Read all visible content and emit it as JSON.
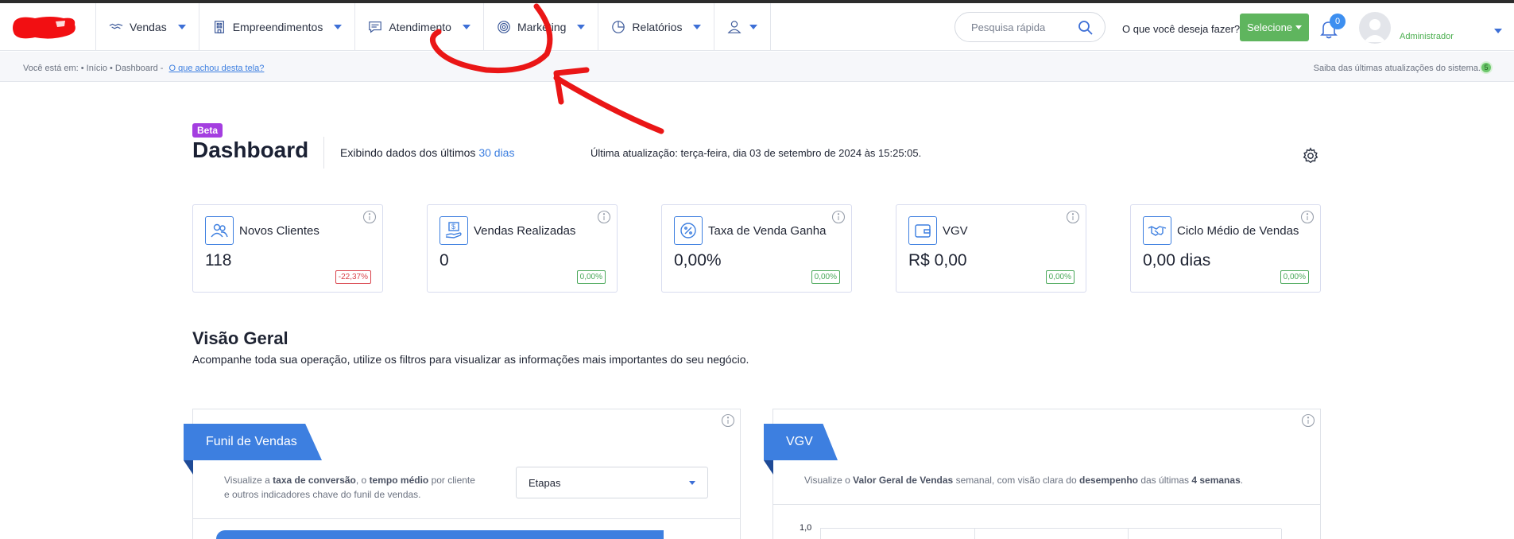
{
  "nav": {
    "items": [
      {
        "label": "Vendas",
        "icon": "handshake-icon"
      },
      {
        "label": "Empreendimentos",
        "icon": "building-icon"
      },
      {
        "label": "Atendimento",
        "icon": "chat-icon"
      },
      {
        "label": "Marketing",
        "icon": "target-icon"
      },
      {
        "label": "Relatórios",
        "icon": "pie-chart-icon"
      },
      {
        "label": "",
        "icon": "user-icon"
      }
    ],
    "search_placeholder": "Pesquisa rápida",
    "what_to_do": "O que você deseja fazer?",
    "select_label": "Selecione",
    "notification_count": "0",
    "user_role": "Administrador",
    "accent_color": "#3d7fe0",
    "select_color": "#5fb55e"
  },
  "breadcrumb": {
    "prefix": "Você está em: • Início • Dashboard -",
    "feedback_link": "O que achou desta tela?",
    "updates_text": "Saiba das últimas atualizações do sistema.",
    "updates_count": "5"
  },
  "header": {
    "beta": "Beta",
    "title": "Dashboard",
    "showing_prefix": "Exibindo dados dos últimos",
    "showing_period": "30 dias",
    "last_update": "Última atualização: terça-feira, dia 03 de setembro de 2024 às 15:25:05."
  },
  "kpis": [
    {
      "label": "Novos Clientes",
      "value": "118",
      "change": "-22,37%",
      "trend": "negative",
      "icon": "users-icon"
    },
    {
      "label": "Vendas Realizadas",
      "value": "0",
      "change": "0,00%",
      "trend": "positive",
      "icon": "money-hand-icon"
    },
    {
      "label": "Taxa de Venda Ganha",
      "value": "0,00%",
      "change": "0,00%",
      "trend": "positive",
      "icon": "percent-badge-icon"
    },
    {
      "label": "VGV",
      "value": "R$ 0,00",
      "change": "0,00%",
      "trend": "positive",
      "icon": "wallet-icon"
    },
    {
      "label": "Ciclo Médio de Vendas",
      "value": "0,00 dias",
      "change": "0,00%",
      "trend": "positive",
      "icon": "deal-handshake-icon"
    }
  ],
  "overview": {
    "title": "Visão Geral",
    "subtitle": "Acompanhe toda sua operação, utilize os filtros para visualizar as informações mais importantes do seu negócio."
  },
  "funnel_panel": {
    "ribbon": "Funil de Vendas",
    "desc": {
      "t1": "Visualize a ",
      "b1": "taxa de conversão",
      "t2": ", o ",
      "b2": "tempo médio",
      "t3": " por cliente",
      "t4": "e outros indicadores chave do funil de vendas."
    },
    "select_value": "Etapas"
  },
  "vgv_panel": {
    "ribbon": "VGV",
    "desc": {
      "t1": "Visualize o ",
      "b1": "Valor Geral de Vendas",
      "t2": " semanal, com visão clara do ",
      "b2": "desempenho",
      "t3": " das últimas ",
      "b3": "4 semanas",
      "t4": "."
    },
    "y_top_tick": "1,0"
  }
}
